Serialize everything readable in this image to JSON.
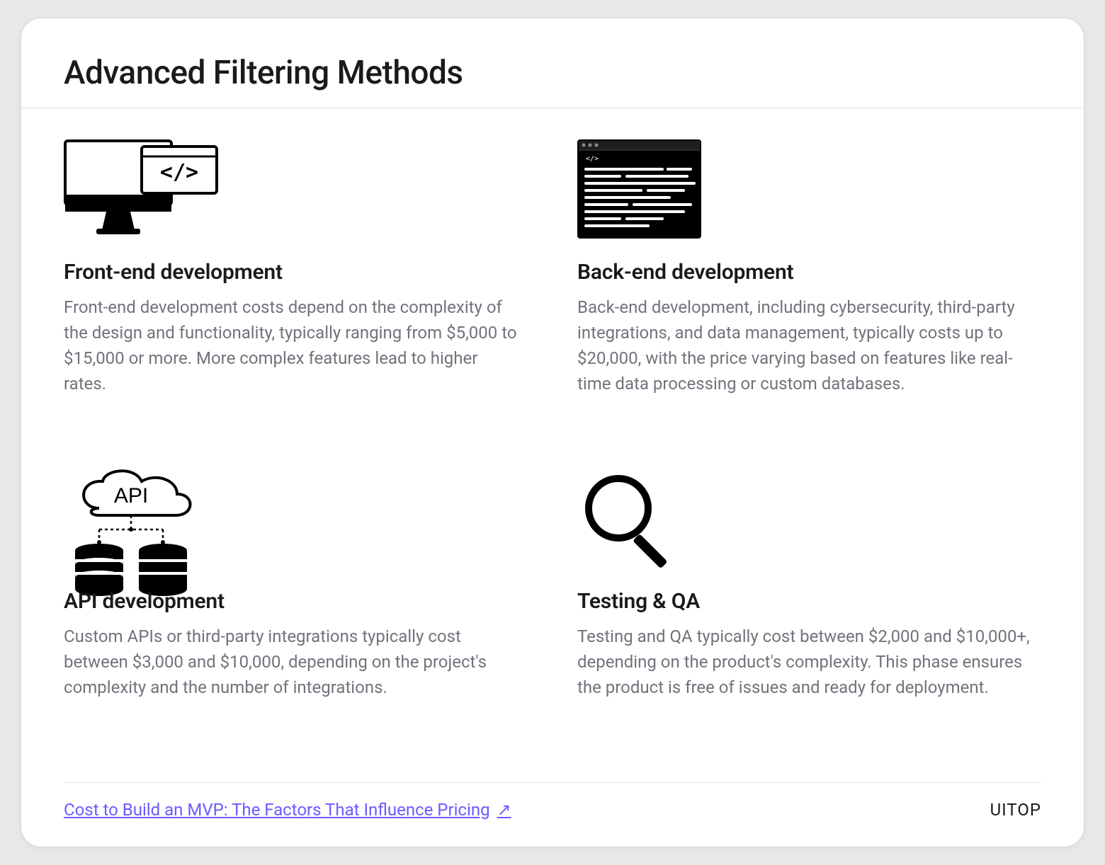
{
  "title": "Advanced Filtering Methods",
  "items": [
    {
      "heading": "Front-end development",
      "body": "Front-end development costs depend on the complexity of the design and functionality, typically ranging from $5,000 to $15,000 or more. More complex features lead to higher rates."
    },
    {
      "heading": "Back-end development",
      "body": "Back-end development, including cybersecurity, third-party integrations, and data management, typically costs up to $20,000, with the price varying based on features like real-time data processing or custom databases."
    },
    {
      "heading": "API development",
      "body": "Custom APIs or third-party integrations typically cost between $3,000 and $10,000, depending on the project's complexity and the number of integrations."
    },
    {
      "heading": "Testing & QA",
      "body": "Testing and QA typically cost between $2,000 and $10,000+, depending on the product's complexity. This phase ensures the product is free of issues and ready for deployment."
    }
  ],
  "footer": {
    "link_text": "Cost to Build an MVP: The Factors That Influence Pricing",
    "brand": "UITOP"
  }
}
